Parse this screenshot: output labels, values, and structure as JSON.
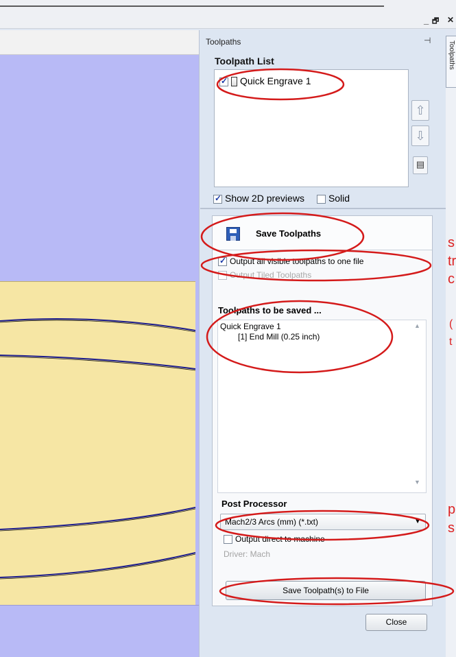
{
  "window": {
    "minimize_glyph": "_",
    "restore_glyph": "🗗",
    "close_glyph": "✕"
  },
  "panel": {
    "title": "Toolpaths",
    "side_tab_label": "Toolpaths",
    "pin_glyph": "⊣"
  },
  "toolpath_list": {
    "title": "Toolpath List",
    "items": [
      {
        "label": "Quick Engrave 1",
        "checked": true
      }
    ],
    "up_glyph": "⇧",
    "down_glyph": "⇩",
    "props_glyph": "▤"
  },
  "previews": {
    "show_2d_label": "Show 2D previews",
    "show_2d_checked": true,
    "solid_label": "Solid",
    "solid_checked": false
  },
  "save": {
    "title": "Save Toolpaths",
    "option_one_file": "Output all visible toolpaths to one file",
    "option_one_file_checked": true,
    "option_tiled": "Output Tiled Toolpaths",
    "to_be_saved_title": "Toolpaths to be saved ...",
    "saved_items": [
      "Quick Engrave 1",
      "[1] End Mill (0.25 inch)"
    ],
    "scroll_up_glyph": "▲",
    "scroll_down_glyph": "▼"
  },
  "post_processor": {
    "title": "Post Processor",
    "selected": "Mach2/3 Arcs (mm) (*.txt)",
    "arrow_glyph": "▼",
    "output_direct": "Output direct to machine",
    "driver": "Driver: Mach"
  },
  "buttons": {
    "save_file": "Save Toolpath(s) to File",
    "close": "Close"
  },
  "annotations": {
    "color": "#d41a1a",
    "edge_text": [
      "s",
      "tr",
      "c",
      "(",
      "t",
      "p",
      "s"
    ]
  }
}
